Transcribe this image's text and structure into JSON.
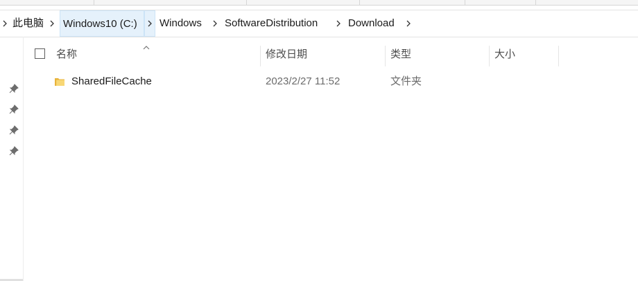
{
  "address_bar": {
    "crumbs": [
      {
        "label": "此电脑",
        "active": false
      },
      {
        "label": "Windows10 (C:)",
        "active": true
      },
      {
        "label": "Windows",
        "active": false
      },
      {
        "label": "SoftwareDistribution",
        "active": false
      },
      {
        "label": "Download",
        "active": false
      }
    ]
  },
  "columns": {
    "name": "名称",
    "date_modified": "修改日期",
    "type": "类型",
    "size": "大小"
  },
  "files": [
    {
      "name": "SharedFileCache",
      "date_modified": "2023/2/27 11:52",
      "type": "文件夹",
      "size": "",
      "icon": "folder-icon"
    }
  ],
  "nav_pane": {
    "pins": [
      "pin-icon",
      "pin-icon",
      "pin-icon",
      "pin-icon"
    ]
  },
  "colors": {
    "accent_bg": "#e5f1fb",
    "accent_border": "#cce4f7",
    "folder_yellow": "#f8d775"
  }
}
